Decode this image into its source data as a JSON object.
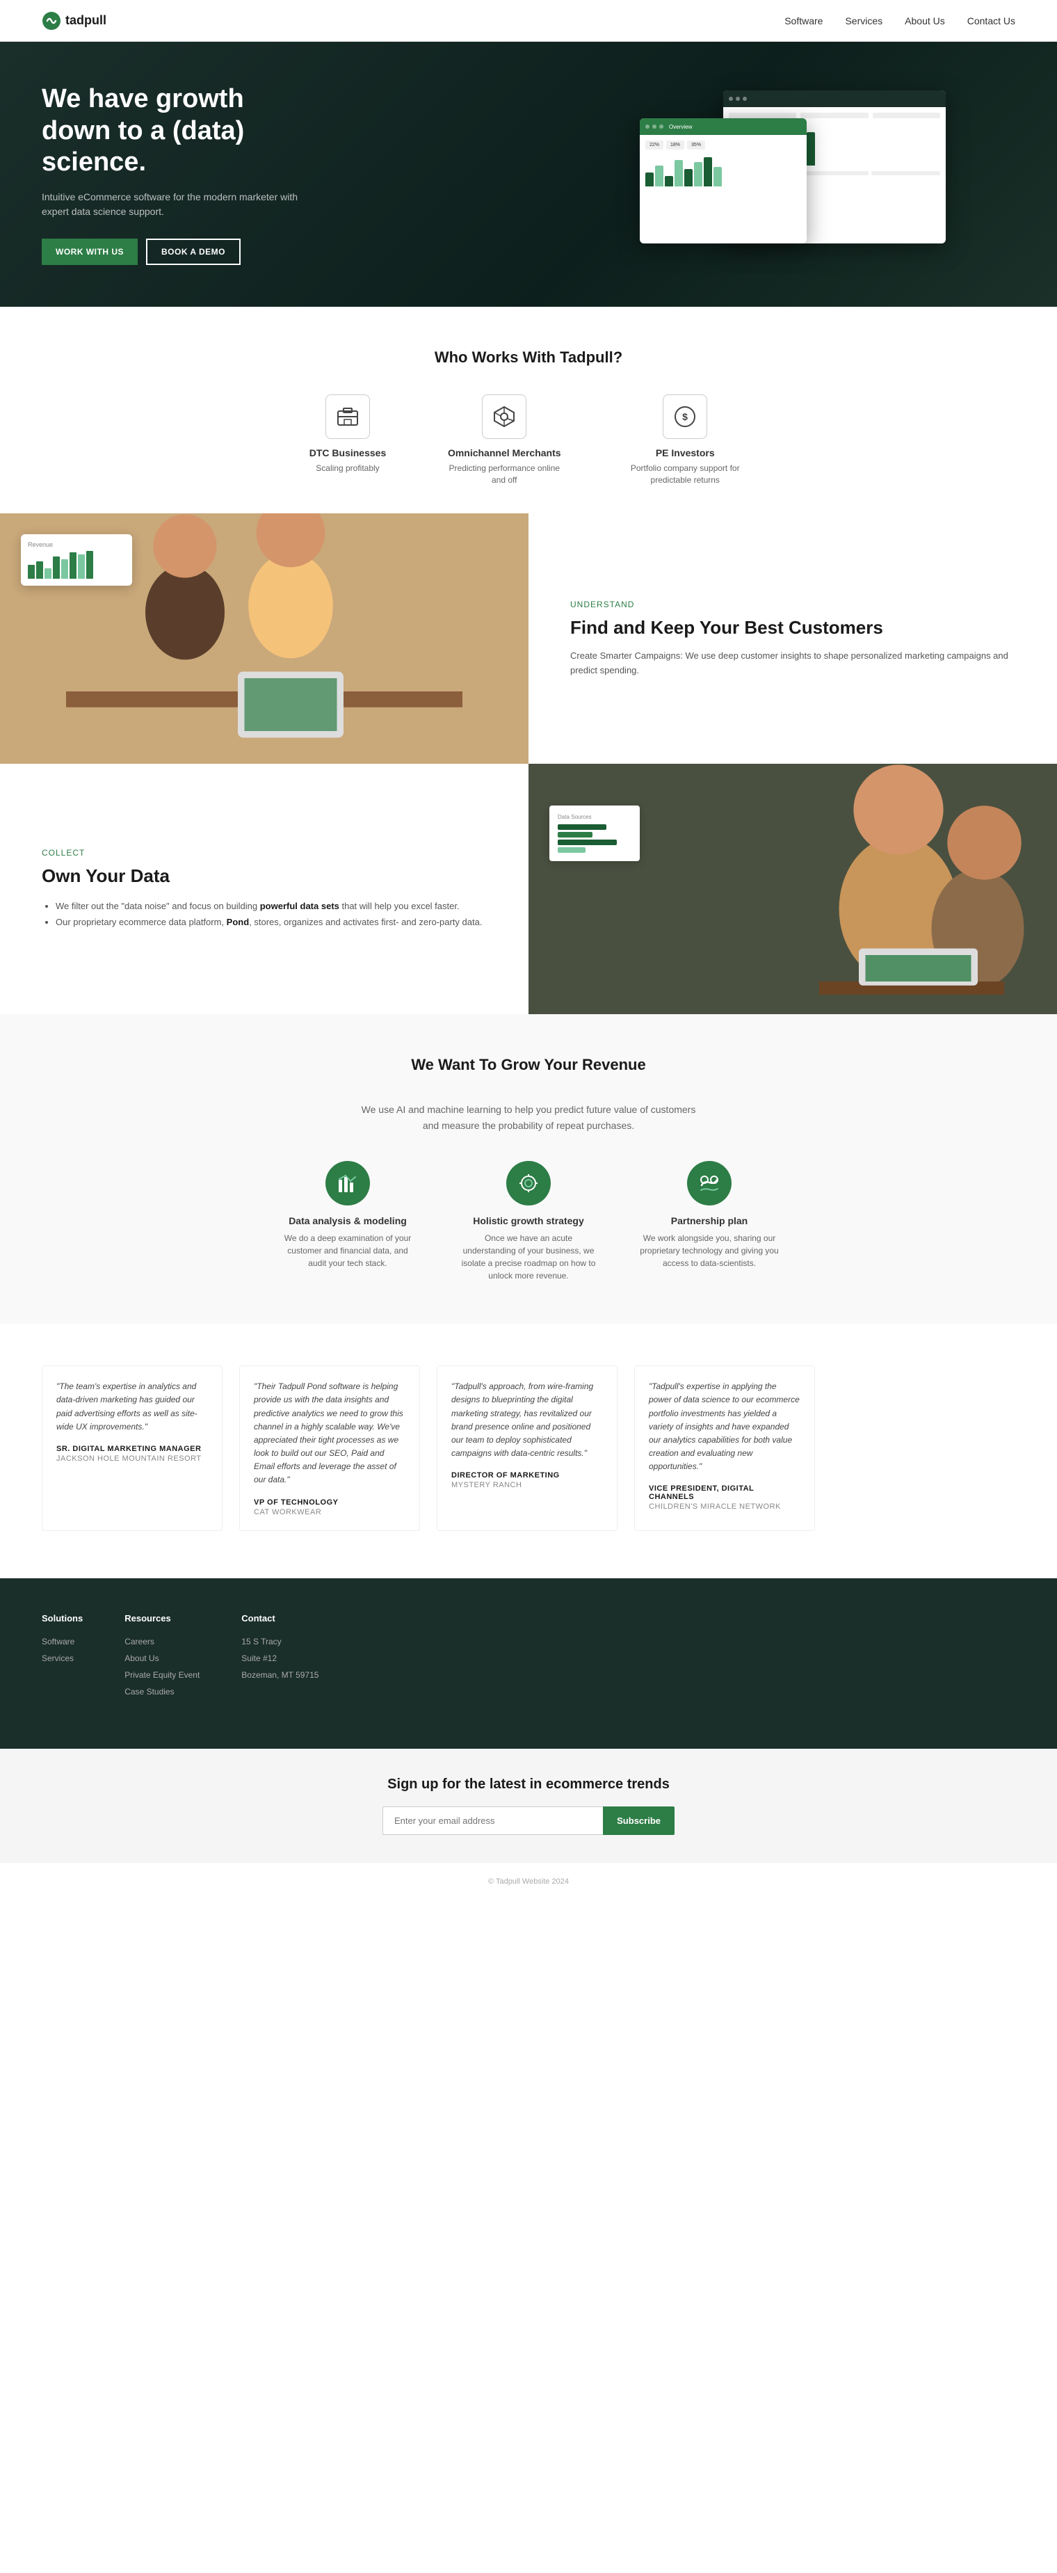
{
  "nav": {
    "logo_text": "tadpull",
    "links": [
      {
        "label": "Software",
        "href": "#"
      },
      {
        "label": "Services",
        "href": "#"
      },
      {
        "label": "About Us",
        "href": "#"
      },
      {
        "label": "Contact Us",
        "href": "#"
      }
    ]
  },
  "hero": {
    "title": "We have growth down to a (data) science.",
    "subtitle": "Intuitive eCommerce software for the modern marketer with expert data science support.",
    "btn_primary": "WORK WITH US",
    "btn_secondary": "BOOK A DEMO"
  },
  "who_works": {
    "heading": "Who Works With Tadpull?",
    "cards": [
      {
        "icon": "🏪",
        "title": "DTC Businesses",
        "desc": "Scaling profitably"
      },
      {
        "icon": "🏠",
        "title": "Omnichannel Merchants",
        "desc": "Predicting performance online and off"
      },
      {
        "icon": "💰",
        "title": "PE Investors",
        "desc": "Portfolio company support for predictable returns"
      }
    ]
  },
  "feature1": {
    "label": "Understand",
    "title": "Find and Keep Your Best Customers",
    "desc": "Create Smarter Campaigns: We use deep customer insights to shape personalized marketing campaigns and predict spending."
  },
  "feature2": {
    "label": "Collect",
    "title": "Own Your Data",
    "list": [
      {
        "text": "We filter out the \"data noise\" and focus on building ",
        "bold": "powerful data sets",
        "rest": " that will help you excel faster."
      },
      {
        "text": "Our proprietary ecommerce data platform, ",
        "bold": "Pond",
        "rest": ", stores, organizes and activates first- and zero-party data."
      }
    ]
  },
  "grow_revenue": {
    "heading": "We Want To Grow Your Revenue",
    "subtitle": "We use AI and machine learning to help you predict future value of customers and measure the probability of repeat purchases.",
    "cards": [
      {
        "icon": "📊",
        "title": "Data analysis & modeling",
        "desc": "We do a deep examination of your customer and financial data, and audit your tech stack."
      },
      {
        "icon": "🤝",
        "title": "Holistic growth strategy",
        "desc": "Once we have an acute understanding of your business, we isolate a precise roadmap on how to unlock more revenue."
      },
      {
        "icon": "🤲",
        "title": "Partnership plan",
        "desc": "We work alongside you, sharing our proprietary technology and giving you access to data-scientists."
      }
    ]
  },
  "testimonials": [
    {
      "text": "\"The team's expertise in analytics and data-driven marketing has guided our paid advertising efforts as well as site-wide UX improvements.\"",
      "author": "Sr. Digital Marketing Manager",
      "company": "JACKSON HOLE MOUNTAIN RESORT"
    },
    {
      "text": "\"Their Tadpull Pond software is helping provide us with the data insights and predictive analytics we need to grow this channel in a highly scalable way. We've appreciated their tight processes as we look to build out our SEO, Paid and Email efforts and leverage the asset of our data.\"",
      "author": "VP of Technology",
      "company": "CAT WORKWEAR"
    },
    {
      "text": "\"Tadpull's approach, from wire-framing designs to blueprinting the digital marketing strategy, has revitalized our brand presence online and positioned our team to deploy sophisticated campaigns with data-centric results.\"",
      "author": "Director of Marketing",
      "company": "MYSTERY RANCH"
    },
    {
      "text": "\"Tadpull's expertise in applying the power of data science to our ecommerce portfolio investments has yielded a variety of insights and have expanded our analytics capabilities for both value creation and evaluating new opportunities.\"",
      "author": "Vice President, Digital Channels",
      "company": "CHILDREN'S MIRACLE NETWORK"
    }
  ],
  "footer": {
    "solutions": {
      "heading": "Solutions",
      "links": [
        "Software",
        "Services"
      ]
    },
    "resources": {
      "heading": "Resources",
      "links": [
        "Careers",
        "About Us",
        "Private Equity Event",
        "Case Studies"
      ]
    },
    "contact": {
      "heading": "Contact",
      "address_line1": "15 S Tracy",
      "address_line2": "Suite #12",
      "address_line3": "Bozeman, MT 59715"
    }
  },
  "email_signup": {
    "title": "Sign up for the latest in ecommerce trends",
    "placeholder": "Enter your email address",
    "button": "Subscribe"
  },
  "footer_bottom": {
    "copyright": "© Tadpull Website 2024"
  }
}
